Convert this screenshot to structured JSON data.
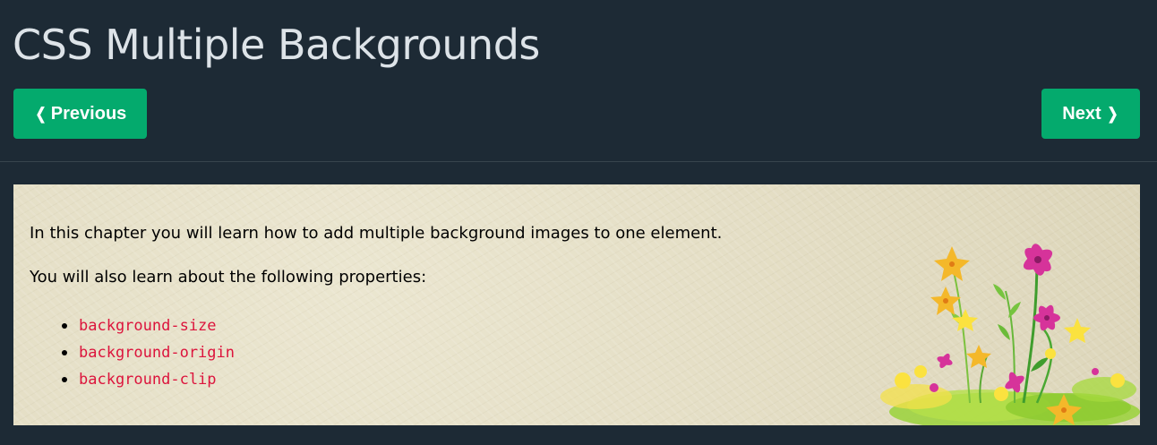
{
  "page": {
    "title": "CSS Multiple Backgrounds"
  },
  "navigation": {
    "previous_label": "Previous",
    "previous_icon": "chevron-left-icon",
    "next_label": "Next",
    "next_icon": "chevron-right-icon",
    "button_color": "#04aa6d"
  },
  "content": {
    "intro": "In this chapter you will learn how to add multiple background images to one element.",
    "properties_intro": "You will also learn about the following properties:",
    "properties": [
      "background-size",
      "background-origin",
      "background-clip"
    ],
    "code_color": "#dc143c"
  },
  "theme": {
    "background": "#1d2a35",
    "title_color": "#dde3e8"
  }
}
